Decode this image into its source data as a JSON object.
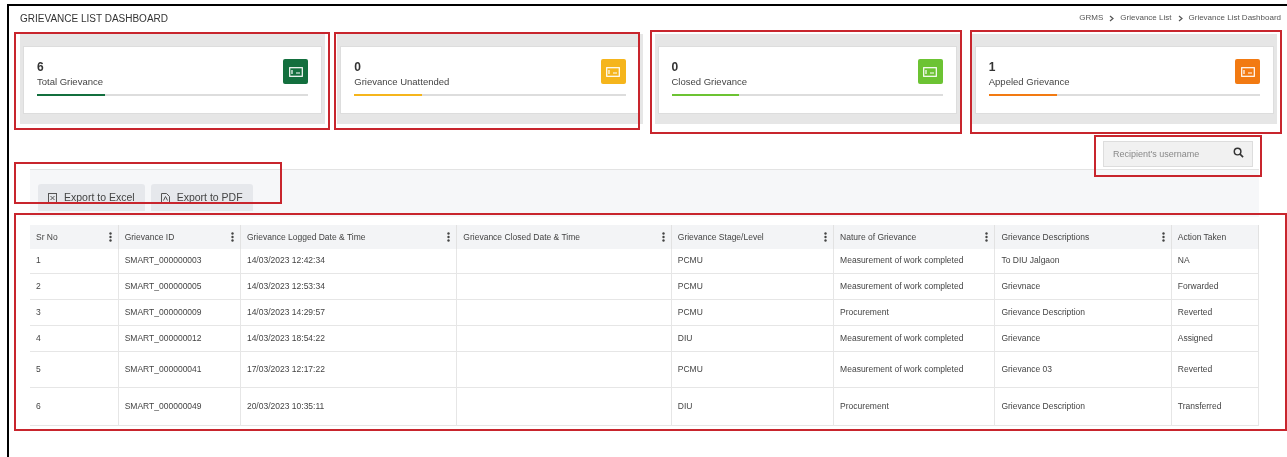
{
  "page_title": "GRIEVANCE LIST DASHBOARD",
  "breadcrumb": [
    "GRMS",
    "Grievance List",
    "Grievance List Dashboard"
  ],
  "stat_cards": [
    {
      "value": "6",
      "label": "Total Grievance",
      "color": "#136f3e",
      "level": 0.25
    },
    {
      "value": "0",
      "label": "Grievance Unattended",
      "color": "#f5b51c",
      "level": 0.25
    },
    {
      "value": "0",
      "label": "Closed Grievance",
      "color": "#6cc333",
      "level": 0.25
    },
    {
      "value": "1",
      "label": "Appeled Grievance",
      "color": "#f27a12",
      "level": 0.25
    }
  ],
  "search": {
    "placeholder": "Recipient's username"
  },
  "export_buttons": [
    {
      "label": "Export to Excel",
      "kind": "excel"
    },
    {
      "label": "Export to PDF",
      "kind": "pdf"
    }
  ],
  "table": {
    "columns": [
      "Sr No",
      "Grievance ID",
      "Grievance Logged Date & Time",
      "Grievance Closed Date & Time",
      "Grievance Stage/Level",
      "Nature of Grievance",
      "Grievance Descriptions",
      "Action Taken"
    ],
    "rows": [
      [
        "1",
        "SMART_000000003",
        "14/03/2023 12:42:34",
        "",
        "PCMU",
        "Measurement of work completed",
        "To DIU Jalgaon",
        "NA"
      ],
      [
        "2",
        "SMART_000000005",
        "14/03/2023 12:53:34",
        "",
        "PCMU",
        "Measurement of work completed",
        "Grievnace",
        "Forwarded"
      ],
      [
        "3",
        "SMART_000000009",
        "14/03/2023 14:29:57",
        "",
        "PCMU",
        "Procurement",
        "Grievance Description",
        "Reverted"
      ],
      [
        "4",
        "SMART_000000012",
        "14/03/2023 18:54:22",
        "",
        "DIU",
        "Measurement of work completed",
        "Grievance",
        "Assigned"
      ],
      [
        "5",
        "SMART_000000041",
        "17/03/2023 12:17:22",
        "",
        "PCMU",
        "Measurement of work completed",
        "Grievance 03",
        "Reverted"
      ],
      [
        "6",
        "SMART_000000049",
        "20/03/2023 10:35:11",
        "",
        "DIU",
        "Procurement",
        "Grievance Description",
        "Transferred"
      ]
    ]
  }
}
